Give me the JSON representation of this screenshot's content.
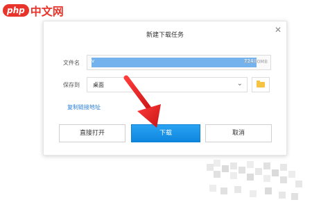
{
  "watermark": {
    "php": "php",
    "site": "中文网"
  },
  "dialog": {
    "title": "新建下载任务",
    "close_icon": "close-icon"
  },
  "filename": {
    "label": "文件名",
    "selected_text": "v",
    "selected_tail": "724",
    "tail_suffix": "更新版",
    "size": "121.00MB"
  },
  "saveto": {
    "label": "保存到",
    "value": "桌面",
    "dropdown_icon": "chevron-down-icon",
    "folder_icon": "folder-icon"
  },
  "copy_link": "复制链接地址",
  "buttons": {
    "open": "直接打开",
    "download": "下载",
    "cancel": "取消"
  },
  "colors": {
    "accent": "#1a92ea",
    "link": "#2b7fd8",
    "annotation_arrow": "#e02020",
    "folder": "#f5c242"
  }
}
